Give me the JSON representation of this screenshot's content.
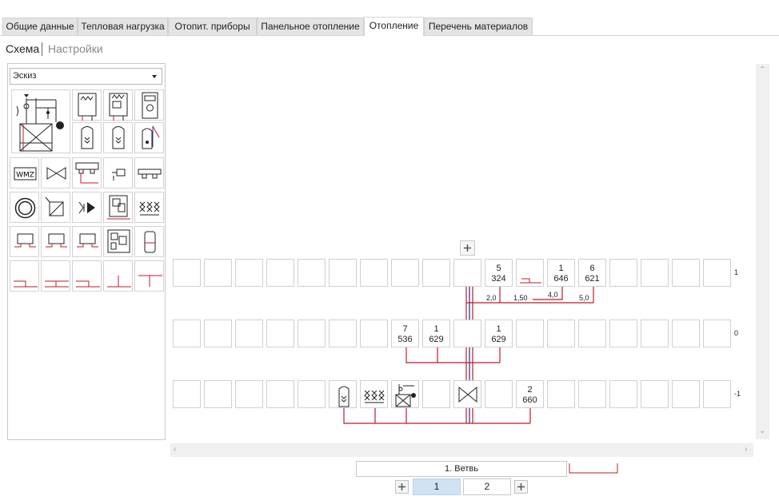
{
  "tabs": [
    {
      "label": "Общие данные",
      "active": false
    },
    {
      "label": "Тепловая нагрузка",
      "active": false
    },
    {
      "label": "Отопит. приборы",
      "active": false
    },
    {
      "label": "Панельное отопление",
      "active": false
    },
    {
      "label": "Отопление",
      "active": true
    },
    {
      "label": "Перечень материалов",
      "active": false
    }
  ],
  "subtabs": {
    "scheme": "Схема",
    "settings": "Настройки"
  },
  "palette": {
    "selected": "Эскиз",
    "icons": [
      "boiler-station-icon",
      "wall-boiler-icon",
      "wall-boiler-control-icon",
      "floor-boiler-icon",
      "floor-boiler-large-icon",
      "tank-icon",
      "tank-2-icon",
      "solar-tank-icon",
      "heat-meter-icon",
      "valve-icon",
      "manifold-icon",
      "radiator-valve-icon",
      "pipe-connector-icon",
      "ring-icon",
      "mixer-icon",
      "pump-icon",
      "station-icon",
      "valve-group-icon",
      "radiator-icon",
      "radiator-2-icon",
      "radiator-3-icon",
      "station-2-icon",
      "cylinder-icon",
      "pipe-tee-icon",
      "pipe-cross-icon",
      "pipe-end-icon",
      "pipe-branch-icon",
      "pipe-top-tee-icon"
    ],
    "wmz_label": "WMZ"
  },
  "scheme": {
    "rows": [
      {
        "label": "1",
        "cells": [
          {
            "col": 10,
            "top": "5",
            "bottom": "324"
          },
          {
            "col": 12,
            "top": "1",
            "bottom": "646"
          },
          {
            "col": 13,
            "top": "6",
            "bottom": "621"
          }
        ]
      },
      {
        "label": "0",
        "cells": [
          {
            "col": 7,
            "top": "7",
            "bottom": "536"
          },
          {
            "col": 8,
            "top": "1",
            "bottom": "629"
          },
          {
            "col": 10,
            "top": "1",
            "bottom": "629"
          }
        ]
      },
      {
        "label": "-1",
        "cells": [
          {
            "col": 11,
            "top": "2",
            "bottom": "660"
          }
        ]
      }
    ],
    "segments": [
      "2,0",
      "1,50",
      "4,0",
      "5,0"
    ]
  },
  "branch": {
    "label": "1. Ветвь"
  },
  "pages": [
    "1",
    "2"
  ],
  "colors": {
    "pipe": "#c0182a",
    "riser": "#1a2a8a",
    "grid": "#d0d0d0"
  }
}
